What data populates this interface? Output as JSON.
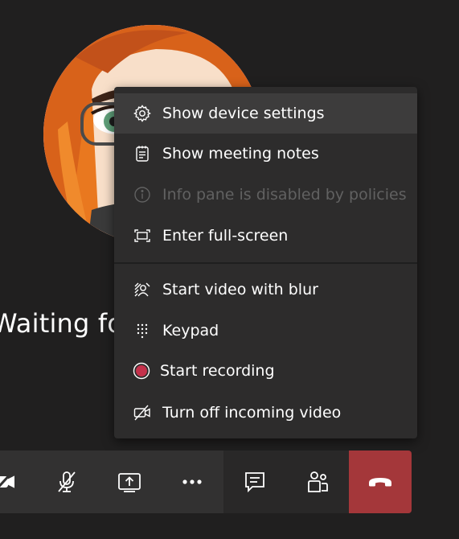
{
  "stage": {
    "waiting_text": "Waiting fo"
  },
  "menu": {
    "items": [
      {
        "label": "Show device settings",
        "icon": "gear-icon",
        "state": "hovered"
      },
      {
        "label": "Show meeting notes",
        "icon": "notes-icon",
        "state": "normal"
      },
      {
        "label": "Info pane is disabled by policies",
        "icon": "info-icon",
        "state": "disabled"
      },
      {
        "label": "Enter full-screen",
        "icon": "fullscreen-icon",
        "state": "normal"
      },
      {
        "label": "Start video with blur",
        "icon": "blur-background-icon",
        "state": "normal"
      },
      {
        "label": "Keypad",
        "icon": "dialpad-icon",
        "state": "normal"
      },
      {
        "label": "Start recording",
        "icon": "record-icon",
        "state": "normal"
      },
      {
        "label": "Turn off incoming video",
        "icon": "video-off-icon",
        "state": "normal"
      }
    ]
  },
  "toolbar": {
    "buttons": [
      {
        "icon": "camera-off-icon"
      },
      {
        "icon": "mic-off-icon"
      },
      {
        "icon": "share-screen-icon"
      },
      {
        "icon": "more-options-icon"
      },
      {
        "icon": "chat-icon"
      },
      {
        "icon": "participants-icon"
      },
      {
        "icon": "hang-up-icon"
      }
    ]
  },
  "colors": {
    "background": "#201f1f",
    "menu_background": "#2d2c2c",
    "menu_hover": "#3d3c3c",
    "disabled_text": "#616161",
    "record_red": "#c4314b",
    "hangup_red": "#a4373a",
    "toolbar_group_a": "#323131",
    "toolbar_group_b": "#292828"
  }
}
